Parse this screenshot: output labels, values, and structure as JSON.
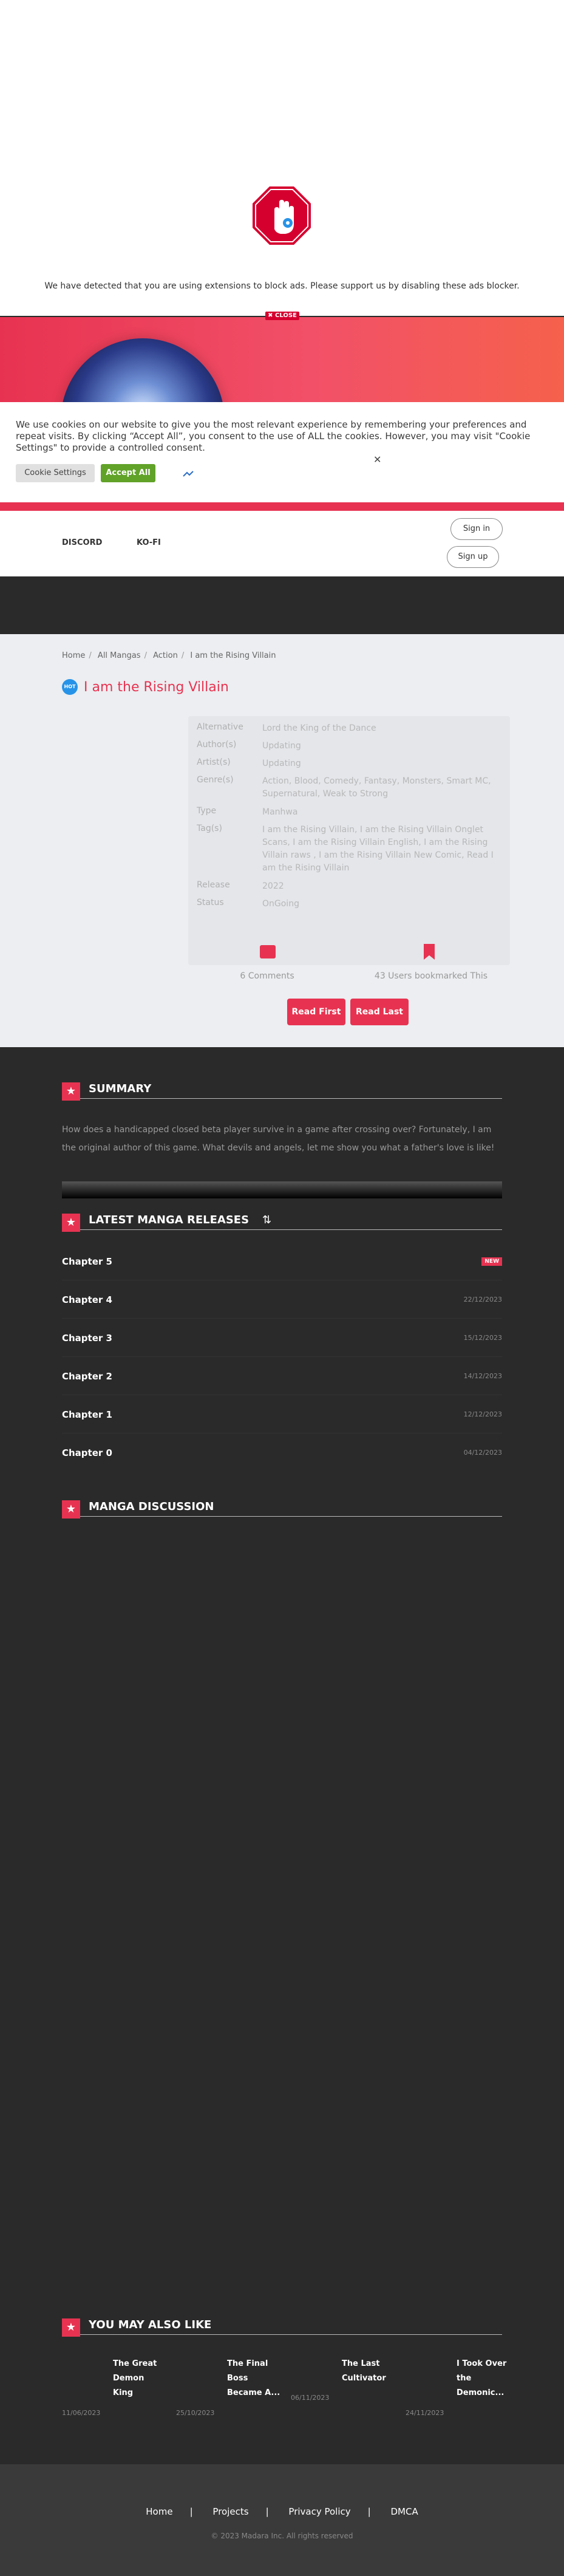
{
  "adblock": {
    "message": "We have detected that you are using extensions to block ads. Please support us by disabling these ads blocker."
  },
  "banner": {
    "close_label": "✖ CLOSE"
  },
  "cookie": {
    "text": "We use cookies on our website to give you the most relevant experience by remembering your preferences and repeat visits. By clicking “Accept All”, you consent to the use of ALL the cookies. However, you may visit \"Cookie Settings\" to provide a controlled consent.",
    "settings_label": "Cookie Settings",
    "accept_label": "Accept All",
    "close_glyph": "✕"
  },
  "nav": {
    "discord": "DISCORD",
    "kofi": "KO-FI",
    "signin": "Sign in",
    "signup": "Sign up"
  },
  "breadcrumb": [
    "Home",
    "All Mangas",
    "Action",
    "I am the Rising Villain"
  ],
  "manga": {
    "badge": "HOT",
    "title": "I am the Rising Villain",
    "info": [
      {
        "label": "Alternative",
        "value": "Lord the King of the Dance"
      },
      {
        "label": "Author(s)",
        "value": "Updating"
      },
      {
        "label": "Artist(s)",
        "value": "Updating"
      },
      {
        "label": "Genre(s)",
        "value": "Action, Blood, Comedy, Fantasy, Monsters, Smart MC, Supernatural, Weak to Strong"
      },
      {
        "label": "Type",
        "value": "Manhwa"
      },
      {
        "label": "Tag(s)",
        "value": "I am the Rising Villain, I am the Rising Villain Onglet Scans, I am the Rising Villain English, I am the Rising Villain raws , I am the Rising Villain New Comic, Read I am the Rising Villain"
      },
      {
        "label": "Release",
        "value": "2022"
      },
      {
        "label": "Status",
        "value": "OnGoing"
      }
    ],
    "comments": "6 Comments",
    "bookmarks": "43 Users bookmarked This",
    "read_first": "Read First",
    "read_last": "Read Last"
  },
  "summary": {
    "heading": "SUMMARY",
    "text": "How does a handicapped closed beta player survive in a game after crossing over? Fortunately, I am the original author of this game. What devils and angels, let me show you what a father's love is like!"
  },
  "releases": {
    "heading": "LATEST MANGA RELEASES",
    "chapters": [
      {
        "name": "Chapter 5",
        "date": "",
        "badge": "NEW"
      },
      {
        "name": "Chapter 4",
        "date": "22/12/2023",
        "badge": ""
      },
      {
        "name": "Chapter 3",
        "date": "15/12/2023",
        "badge": ""
      },
      {
        "name": "Chapter 2",
        "date": "14/12/2023",
        "badge": ""
      },
      {
        "name": "Chapter 1",
        "date": "12/12/2023",
        "badge": ""
      },
      {
        "name": "Chapter 0",
        "date": "04/12/2023",
        "badge": ""
      }
    ]
  },
  "discussion": {
    "heading": "MANGA DISCUSSION"
  },
  "also_like": {
    "heading": "YOU MAY ALSO LIKE",
    "items": [
      {
        "title_lines": [
          "The Great",
          "Demon",
          "King"
        ],
        "date": "11/06/2023"
      },
      {
        "title_lines": [
          "The Final",
          "Boss",
          "Became A..."
        ],
        "date": "25/10/2023"
      },
      {
        "title_lines": [
          "The Last",
          "Cultivator"
        ],
        "date": "06/11/2023"
      },
      {
        "title_lines": [
          "I Took Over",
          "the",
          "Demonic..."
        ],
        "date": "24/11/2023"
      }
    ]
  },
  "footer": {
    "links": [
      "Home",
      "Projects",
      "Privacy Policy",
      "DMCA"
    ],
    "copyright": "© 2023 Madara Inc. All rights reserved"
  },
  "colors": {
    "accent": "#e73351",
    "accept_green": "#61a229",
    "hot_blue": "#2793e8"
  }
}
